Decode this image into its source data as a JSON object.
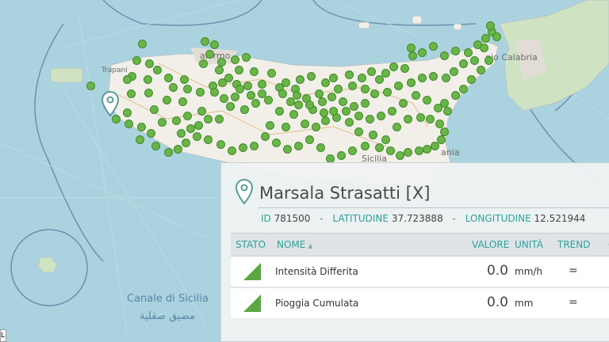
{
  "map": {
    "labels": {
      "palermo": "alermo",
      "trapani": "Trapani",
      "reggio": "gio Calabria",
      "sicilia": "Sicilia",
      "catania": "ania",
      "sea_it": "Canale di Sicilia",
      "sea_ar": "مضيق صقلية"
    },
    "station_color": "#6ab547",
    "selected_pin_color": "#7fb8b2"
  },
  "panel": {
    "title": "Marsala Strasatti [X]",
    "meta": {
      "id_label": "ID",
      "id_value": "781500",
      "lat_label": "LATITUDINE",
      "lat_value": "37.723888",
      "lon_label": "LONGITUDINE",
      "lon_value": "12.521944"
    },
    "columns": {
      "stato": "STATO",
      "nome": "NOME",
      "valore": "VALORE",
      "unita": "UNITÀ",
      "trend": "TREND",
      "extra": "C"
    },
    "rows": [
      {
        "name": "Intensità Differita",
        "value": "0.0",
        "unit": "mm/h",
        "trend": "="
      },
      {
        "name": "Pioggia Cumulata",
        "value": "0.0",
        "unit": "mm",
        "trend": "="
      }
    ]
  },
  "attribution": "L"
}
